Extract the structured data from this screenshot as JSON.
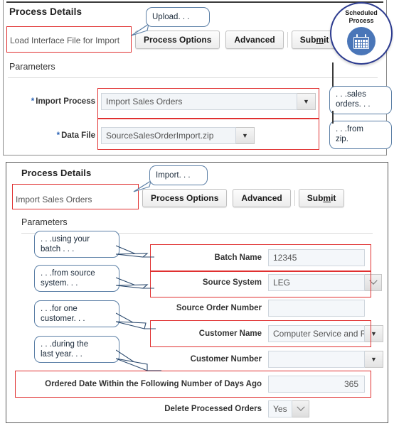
{
  "top_panel": {
    "title": "Process Details",
    "process_name": "Load Interface File for Import",
    "buttons": {
      "process_options": "Process Options",
      "advanced": "Advanced",
      "submit_pre": "Sub",
      "submit_key": "m",
      "submit_post": "it"
    },
    "parameters_label": "Parameters",
    "fields": [
      {
        "label": "Import Process",
        "required": true,
        "value": "Import Sales Orders",
        "control": "dropdown-triangle"
      },
      {
        "label": "Data File",
        "required": true,
        "value": "SourceSalesOrderImport.zip",
        "control": "dropdown-triangle"
      }
    ],
    "callouts": [
      {
        "id": "upload",
        "text": "Upload. . ."
      },
      {
        "id": "sales-orders",
        "text": ". . .sales\norders. . ."
      },
      {
        "id": "from-zip",
        "text": ". . .from\nzip."
      }
    ]
  },
  "badge": {
    "line1": "Scheduled",
    "line2": "Process",
    "icon": "calendar-icon"
  },
  "bottom_panel": {
    "title": "Process Details",
    "process_name": "Import Sales Orders",
    "buttons": {
      "process_options": "Process Options",
      "advanced": "Advanced",
      "submit_pre": "Sub",
      "submit_key": "m",
      "submit_post": "it"
    },
    "parameters_label": "Parameters",
    "fields": [
      {
        "label": "Batch Name",
        "value": "12345",
        "control": "text",
        "highlighted": true
      },
      {
        "label": "Source System",
        "value": "LEG",
        "control": "dropdown-chevron",
        "highlighted": true
      },
      {
        "label": "Source Order Number",
        "value": "",
        "control": "text",
        "highlighted": false
      },
      {
        "label": "Customer Name",
        "value": "Computer Service and R",
        "control": "dropdown-triangle",
        "highlighted": true
      },
      {
        "label": "Customer Number",
        "value": "",
        "control": "dropdown-triangle",
        "highlighted": false
      },
      {
        "label": "Ordered Date Within the Following Number of Days Ago",
        "value": "365",
        "control": "number",
        "highlighted": true
      },
      {
        "label": "Delete Processed Orders",
        "value": "Yes",
        "control": "dropdown-chevron-small",
        "highlighted": false
      }
    ],
    "callouts": [
      {
        "id": "import",
        "text": "Import. . ."
      },
      {
        "id": "batch",
        "text": ". . .using your\nbatch . . ."
      },
      {
        "id": "source-system",
        "text": ". . .from source\nsystem. . ."
      },
      {
        "id": "customer",
        "text": ". . .for one\ncustomer. . ."
      },
      {
        "id": "last-year",
        "text": ". . .during the\nlast year. . ."
      }
    ]
  },
  "colors": {
    "highlight": "#e03030",
    "badge_border": "#2b3a8f",
    "badge_icon": "#4a76b8",
    "callout_border": "#5b7fa6",
    "required_star": "#2a63b5"
  }
}
